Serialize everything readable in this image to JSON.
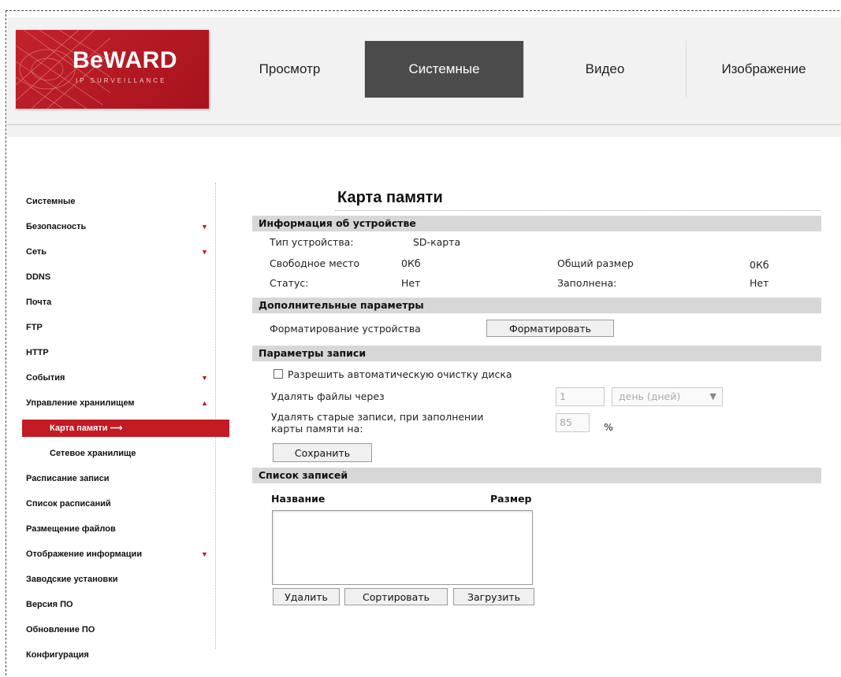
{
  "logo": {
    "text": "BeWARD",
    "sub": "IP SURVEILLANCE"
  },
  "topnav": [
    {
      "label": "Просмотр",
      "active": false
    },
    {
      "label": "Системные",
      "active": true
    },
    {
      "label": "Видео",
      "active": false
    },
    {
      "label": "Изображение",
      "active": false
    }
  ],
  "sidebar": {
    "items": [
      {
        "label": "Системные"
      },
      {
        "label": "Безопасность"
      },
      {
        "label": "Сеть"
      },
      {
        "label": "DDNS"
      },
      {
        "label": "Почта"
      },
      {
        "label": "FTP"
      },
      {
        "label": "HTTP"
      },
      {
        "label": "События"
      },
      {
        "label": "Управление хранилищем"
      },
      {
        "label": "Карта памяти",
        "suffix": "⟶"
      },
      {
        "label": "Сетевое хранилище"
      },
      {
        "label": "Расписание записи"
      },
      {
        "label": "Список расписаний"
      },
      {
        "label": "Размещение файлов"
      },
      {
        "label": "Отображение информации"
      },
      {
        "label": "Заводские установки"
      },
      {
        "label": "Версия ПО"
      },
      {
        "label": "Обновление ПО"
      },
      {
        "label": "Конфигурация"
      }
    ]
  },
  "page": {
    "title": "Карта памяти"
  },
  "device_info": {
    "header": "Информация об устройстве",
    "type_label": "Тип устройства:",
    "type_value": "SD-карта",
    "free_label": "Свободное место",
    "free_value": "0Кб",
    "total_label": "Общий размер",
    "total_value": "0Кб",
    "status_label": "Статус:",
    "status_value": "Нет",
    "full_label": "Заполнена:",
    "full_value": "Нет"
  },
  "extra": {
    "header": "Дополнительные параметры",
    "format_label": "Форматирование устройства",
    "format_button": "Форматировать"
  },
  "record": {
    "header": "Параметры записи",
    "auto_clean_label": "Разрешить автоматическую очистку диска",
    "delete_after_label": "Удалять файлы через",
    "delete_after_value": "1",
    "delete_after_unit": "день (дней)",
    "delete_old_label_1": "Удалять старые записи, при заполнении",
    "delete_old_label_2": "карты памяти на:",
    "delete_old_value": "85",
    "delete_old_unit": "%",
    "save_button": "Сохранить"
  },
  "records_list": {
    "header": "Список записей",
    "col_name": "Название",
    "col_size": "Размер",
    "delete_button": "Удалить",
    "sort_button": "Сортировать",
    "download_button": "Загрузить"
  }
}
